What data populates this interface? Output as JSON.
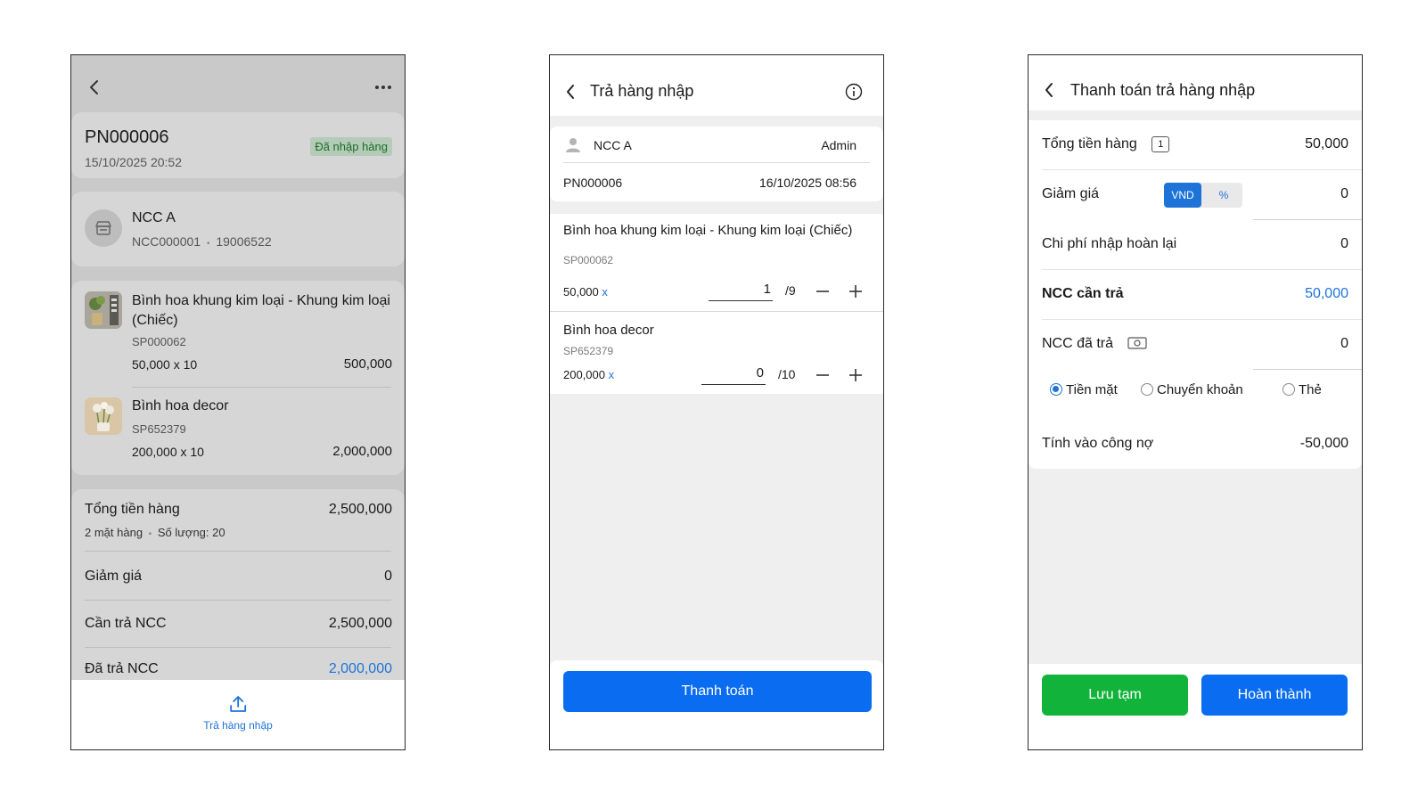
{
  "screen1": {
    "order_code": "PN000006",
    "order_datetime": "15/10/2025 20:52",
    "status_badge": "Đã nhập hàng",
    "supplier": {
      "name": "NCC A",
      "code": "NCC000001",
      "phone": "19006522",
      "dot": "•"
    },
    "items": [
      {
        "name": "Bình hoa khung kim loại - Khung kim loại (Chiếc)",
        "sku": "SP000062",
        "price_qty": "50,000 x 10",
        "total": "500,000"
      },
      {
        "name": "Bình hoa decor",
        "sku": "SP652379",
        "price_qty": "200,000 x 10",
        "total": "2,000,000"
      }
    ],
    "summary": {
      "total_label": "Tổng tiền hàng",
      "total_value": "2,500,000",
      "total_sub_items": "2 mặt hàng",
      "total_sub_qty": "Số lượng: 20",
      "discount_label": "Giảm giá",
      "discount_value": "0",
      "payable_label": "Cần trả NCC",
      "payable_value": "2,500,000",
      "paid_label": "Đã trả NCC",
      "paid_value": "2,000,000"
    },
    "footer_action": "Trả hàng nhập"
  },
  "screen2": {
    "title": "Trả hàng nhập",
    "supplier": "NCC A",
    "user": "Admin",
    "order_code": "PN000006",
    "datetime": "16/10/2025 08:56",
    "items": [
      {
        "name": "Bình hoa khung kim loại - Khung kim loại (Chiếc)",
        "sku": "SP000062",
        "price": "50,000",
        "price_x": "x",
        "qty": "1",
        "max": "/9"
      },
      {
        "name": "Bình hoa decor",
        "sku": "SP652379",
        "price": "200,000",
        "price_x": "x",
        "qty": "0",
        "max": "/10"
      }
    ],
    "pay_button": "Thanh toán"
  },
  "screen3": {
    "title": "Thanh toán trả hàng nhập",
    "rows": {
      "total_label": "Tổng tiền hàng",
      "total_count": "1",
      "total_value": "50,000",
      "discount_label": "Giảm giá",
      "discount_toggle_vnd": "VND",
      "discount_toggle_pct": "%",
      "discount_value": "0",
      "refund_cost_label": "Chi phí nhập hoàn lại",
      "refund_cost_value": "0",
      "ncc_due_label": "NCC cần trả",
      "ncc_due_value": "50,000",
      "ncc_paid_label": "NCC đã trả",
      "ncc_paid_value": "0"
    },
    "payment_methods": [
      {
        "label": "Tiền mặt",
        "selected": true
      },
      {
        "label": "Chuyển khoản",
        "selected": false
      },
      {
        "label": "Thẻ",
        "selected": false
      }
    ],
    "debt_label": "Tính vào công nợ",
    "debt_value": "-50,000",
    "save_draft_button": "Lưu tạm",
    "complete_button": "Hoàn thành"
  },
  "colors": {
    "primary_blue": "#0a6cf0",
    "link_blue": "#1e73d9",
    "success_green": "#12b33a",
    "badge_bg": "#b4ccb7",
    "badge_text": "#1f6a2a"
  }
}
